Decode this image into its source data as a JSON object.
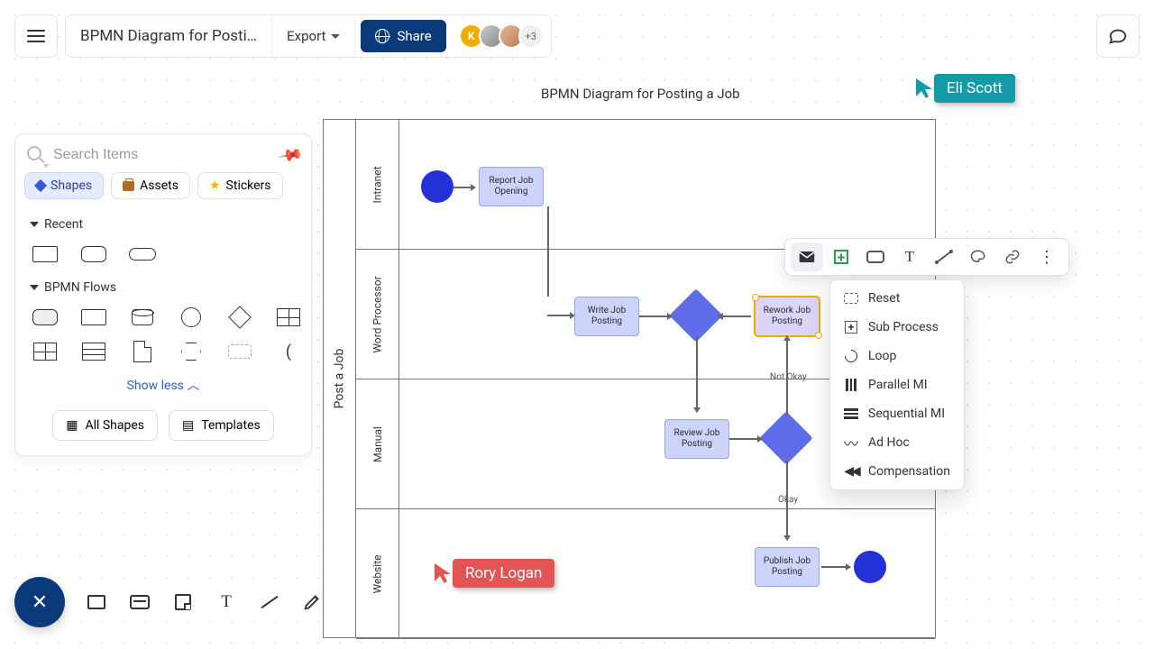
{
  "header": {
    "title": "BPMN Diagram for Posti…",
    "export": "Export",
    "share": "Share",
    "avatar_k": "K",
    "avatar_plus": "+3"
  },
  "canvas": {
    "title": "BPMN Diagram for Posting a Job"
  },
  "pool": {
    "label": "Post a Job",
    "lanes": [
      "Intranet",
      "Word Processor",
      "Manual",
      "Website"
    ]
  },
  "tasks": {
    "report": "Report Job Opening",
    "write": "Write Job Posting",
    "rework": "Rework Job Posting",
    "review": "Review Job Posting",
    "publish": "Publish Job Posting"
  },
  "edges": {
    "okay": "Okay",
    "not_okay": "Not Okay"
  },
  "sidebar": {
    "search_placeholder": "Search Items",
    "tabs": {
      "shapes": "Shapes",
      "assets": "Assets",
      "stickers": "Stickers"
    },
    "recent": "Recent",
    "bpmn": "BPMN Flows",
    "showless": "Show less",
    "all_shapes": "All Shapes",
    "templates": "Templates"
  },
  "ctx_menu": {
    "reset": "Reset",
    "subprocess": "Sub Process",
    "loop": "Loop",
    "parallel": "Parallel MI",
    "sequential": "Sequential MI",
    "adhoc": "Ad Hoc",
    "compensation": "Compensation"
  },
  "cursors": {
    "eli": "Eli Scott",
    "rory": "Rory Logan"
  }
}
